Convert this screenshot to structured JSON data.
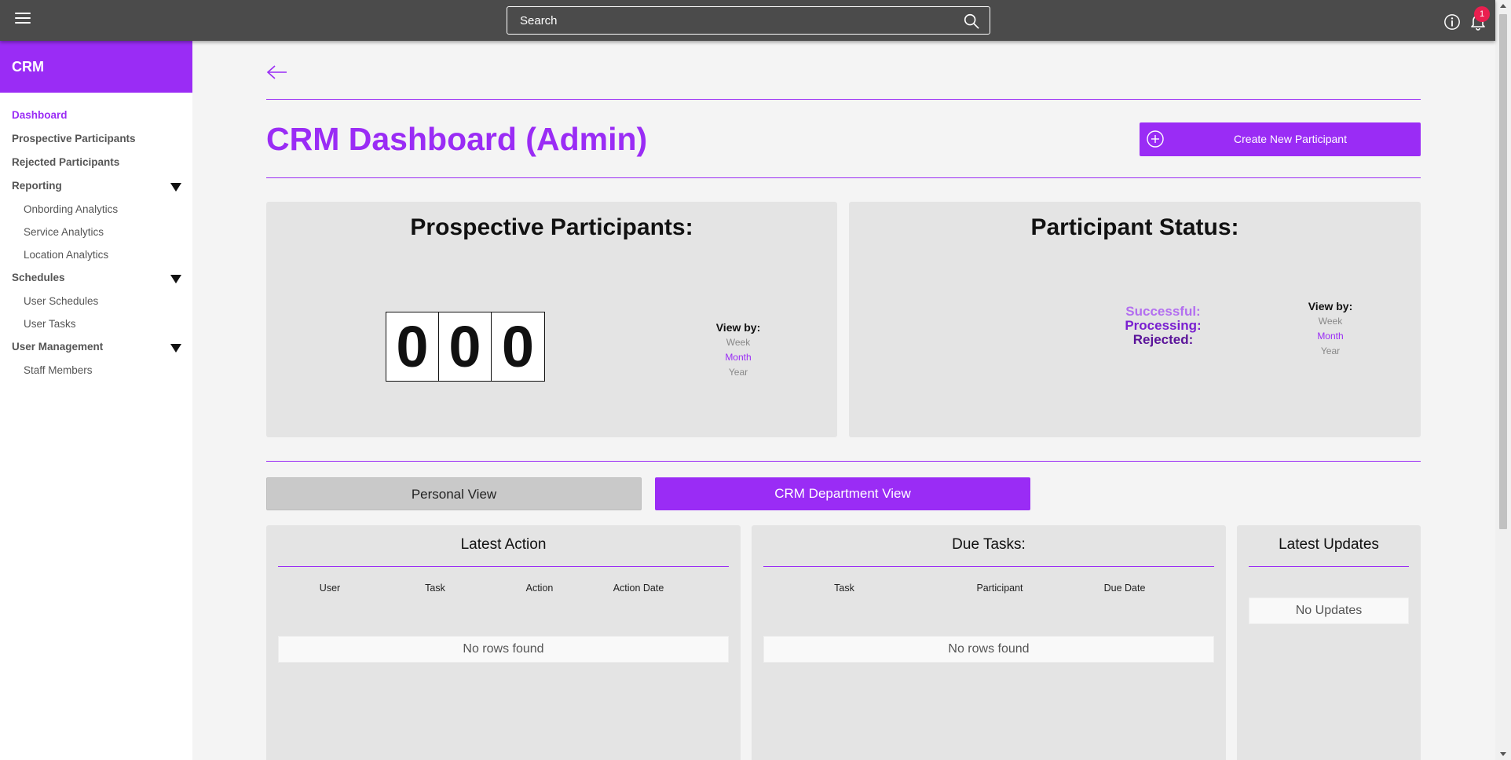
{
  "topbar": {
    "search_placeholder": "Search",
    "notification_count": "1",
    "icons": [
      "hamburger-icon",
      "search-icon",
      "info-icon",
      "bell-icon"
    ]
  },
  "sidebar": {
    "title": "CRM",
    "items": [
      {
        "label": "Dashboard",
        "active": true
      },
      {
        "label": "Prospective Participants"
      },
      {
        "label": "Rejected Participants"
      },
      {
        "label": "Reporting",
        "expandable": true
      },
      {
        "label": "Onbording Analytics",
        "sub": true
      },
      {
        "label": "Service Analytics",
        "sub": true
      },
      {
        "label": "Location Analytics",
        "sub": true
      },
      {
        "label": "Schedules",
        "expandable": true
      },
      {
        "label": "User Schedules",
        "sub": true
      },
      {
        "label": "User Tasks",
        "sub": true
      },
      {
        "label": "User Management",
        "expandable": true
      },
      {
        "label": "Staff Members",
        "sub": true
      }
    ]
  },
  "header": {
    "title": "CRM Dashboard (Admin)",
    "create_button": "Create New Participant"
  },
  "prospective": {
    "title": "Prospective Participants:",
    "digits": [
      "0",
      "0",
      "0"
    ],
    "view_by": {
      "label": "View by:",
      "options": [
        "Week",
        "Month",
        "Year"
      ],
      "selected": "Month"
    }
  },
  "status": {
    "title": "Participant Status:",
    "successful": "Successful:",
    "processing": "Processing:",
    "rejected": "Rejected:",
    "view_by": {
      "label": "View by:",
      "options": [
        "Week",
        "Month",
        "Year"
      ],
      "selected": "Month"
    }
  },
  "view_tabs": {
    "personal": "Personal View",
    "department": "CRM Department View",
    "active": "department"
  },
  "latest_action": {
    "title": "Latest Action",
    "columns": [
      "User",
      "Task",
      "Action",
      "Action Date"
    ],
    "empty": "No rows found"
  },
  "due_tasks": {
    "title": "Due Tasks:",
    "columns": [
      "Task",
      "Participant",
      "Due Date"
    ],
    "empty": "No rows found"
  },
  "latest_updates": {
    "title": "Latest Updates",
    "empty": "No Updates"
  },
  "colors": {
    "accent": "#9a2cf5",
    "topbar": "#4b4b4b",
    "card": "#e4e4e4",
    "successful": "#b36ff0",
    "processing": "#7a1fd0",
    "rejected": "#5a1399",
    "badge": "#ea1f4f"
  }
}
